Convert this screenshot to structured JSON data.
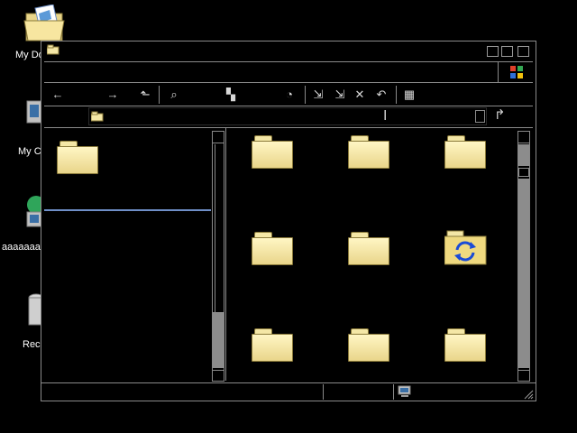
{
  "desktop": {
    "icons": [
      {
        "label": "My Do",
        "icon": "open-folder-icon"
      },
      {
        "label": "My C",
        "icon": "computer-icon"
      },
      {
        "label": "aaaaaaa",
        "icon": "network-icon"
      },
      {
        "label": "Rec",
        "icon": "recycle-bin-icon"
      }
    ]
  },
  "window": {
    "title": "",
    "toolbar": [
      {
        "name": "back",
        "glyph": "←"
      },
      {
        "name": "forward",
        "glyph": "→"
      },
      {
        "name": "up-folder",
        "glyph": "⬑"
      },
      {
        "name": "search",
        "glyph": "⌕"
      },
      {
        "name": "folders",
        "glyph": "▚"
      },
      {
        "name": "history",
        "glyph": "◔"
      },
      {
        "name": "move-to",
        "glyph": "⇲"
      },
      {
        "name": "copy-to",
        "glyph": "⇲"
      },
      {
        "name": "delete",
        "glyph": "✕"
      },
      {
        "name": "undo",
        "glyph": "↶"
      },
      {
        "name": "views",
        "glyph": "▦"
      }
    ],
    "address": {
      "value": "",
      "go_icon": "go-arrow-icon"
    },
    "files": [
      {
        "name": "",
        "type": "folder"
      },
      {
        "name": "",
        "type": "folder"
      },
      {
        "name": "",
        "type": "folder"
      },
      {
        "name": "",
        "type": "folder"
      },
      {
        "name": "",
        "type": "folder"
      },
      {
        "name": "",
        "type": "sync-folder"
      },
      {
        "name": "",
        "type": "folder"
      },
      {
        "name": "",
        "type": "folder"
      },
      {
        "name": "",
        "type": "folder"
      }
    ],
    "status": {
      "left": "",
      "middle": "",
      "right_icon": "computer-icon"
    }
  },
  "colors": {
    "frame": "#8a8a8a",
    "folder": "#f4e7a6",
    "accent_line": "#6f8fc8",
    "sync_arrows": "#1a4bd6"
  }
}
